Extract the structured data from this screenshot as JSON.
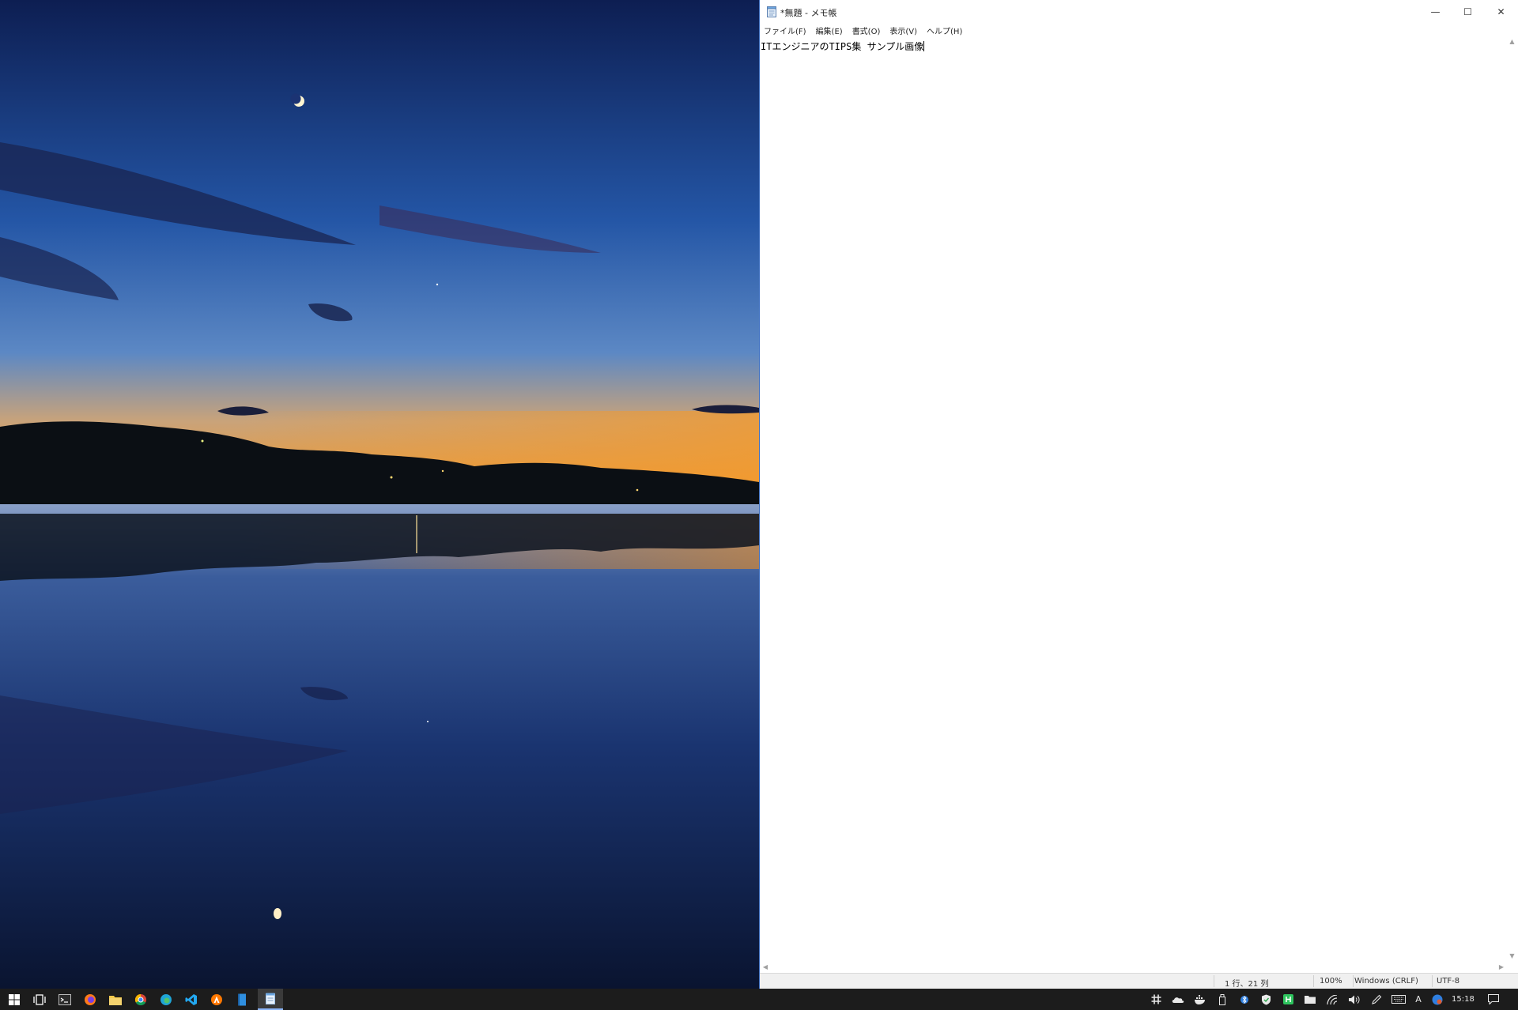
{
  "window": {
    "title": "*無題 - メモ帳",
    "min_glyph": "—",
    "max_glyph": "☐",
    "close_glyph": "✕"
  },
  "menu": [
    {
      "label": "ファイル(F)"
    },
    {
      "label": "編集(E)"
    },
    {
      "label": "書式(O)"
    },
    {
      "label": "表示(V)"
    },
    {
      "label": "ヘルプ(H)"
    }
  ],
  "editor": {
    "content": "ITエンジニアのTIPS集 サンプル画像"
  },
  "status": {
    "position": "1 行、21 列",
    "zoom": "100%",
    "line_ending": "Windows (CRLF)",
    "encoding": "UTF-8"
  },
  "taskbar": {
    "apps": [
      {
        "name": "start-button",
        "icon": "windows-logo-icon"
      },
      {
        "name": "task-view-button",
        "icon": "task-view-icon"
      },
      {
        "name": "taskbar-app-terminal",
        "icon": "terminal-icon"
      },
      {
        "name": "taskbar-app-firefox",
        "icon": "firefox-icon"
      },
      {
        "name": "taskbar-app-explorer",
        "icon": "folder-icon"
      },
      {
        "name": "taskbar-app-chrome",
        "icon": "chrome-icon"
      },
      {
        "name": "taskbar-app-edge",
        "icon": "edge-icon"
      },
      {
        "name": "taskbar-app-vscode",
        "icon": "vscode-icon"
      },
      {
        "name": "taskbar-app-avast",
        "icon": "avast-icon"
      },
      {
        "name": "taskbar-app-bookmark",
        "icon": "bookmark-icon"
      },
      {
        "name": "taskbar-app-notepad",
        "icon": "notepad-icon"
      }
    ],
    "tray": {
      "ime_label": "A",
      "clock": "15:18"
    }
  },
  "colors": {
    "taskbar_bg": "#1c1c1c",
    "accent": "#8ab4f8"
  }
}
